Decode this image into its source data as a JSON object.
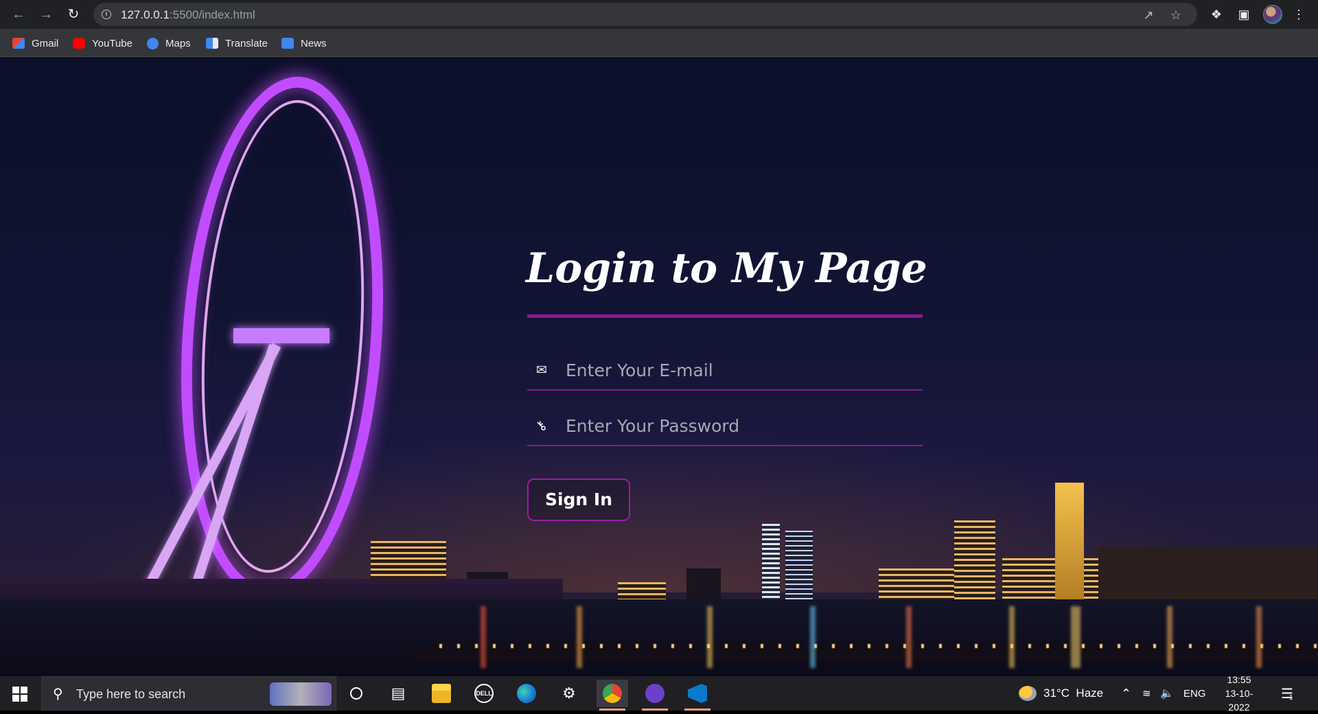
{
  "browser": {
    "url_host": "127.0.0.1",
    "url_path": ":5500/index.html",
    "bookmarks": [
      {
        "label": "Gmail",
        "icon": "gmail-icon",
        "color": "#ea4335"
      },
      {
        "label": "YouTube",
        "icon": "youtube-icon",
        "color": "#ff0000"
      },
      {
        "label": "Maps",
        "icon": "maps-icon",
        "color": "#4285f4"
      },
      {
        "label": "Translate",
        "icon": "translate-icon",
        "color": "#4285f4"
      },
      {
        "label": "News",
        "icon": "news-icon",
        "color": "#4285f4"
      }
    ]
  },
  "login": {
    "title": "Login to My Page",
    "email_placeholder": "Enter Your E-mail",
    "password_placeholder": "Enter Your Password",
    "signin_label": "Sign In",
    "accent_color": "#8b1a8f"
  },
  "taskbar": {
    "search_placeholder": "Type here to search",
    "weather": "31°C  Haze",
    "language": "ENG",
    "time": "13:55",
    "date": "13-10-2022",
    "notification_count": "1"
  }
}
